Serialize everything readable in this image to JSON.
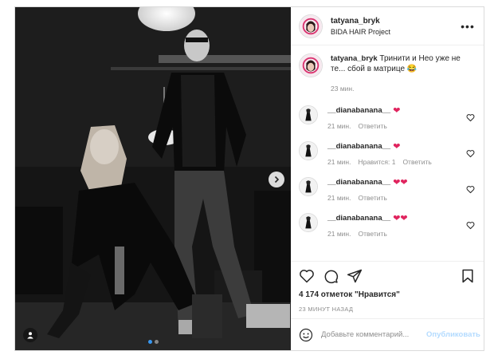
{
  "post": {
    "username": "tatyana_bryk",
    "location": "BIDA HAIR Project",
    "caption_text": "Тринити и Нео уже не те... сбой в матрице 😂",
    "caption_time": "23 мин.",
    "likes": "4 174 отметок \"Нравится\"",
    "posted_ago": "23 МИНУТ НАЗАД",
    "comment_placeholder": "Добавьте комментарий...",
    "publish_label": "Опубликовать",
    "carousel": {
      "total": 2,
      "active": 1
    }
  },
  "comments": [
    {
      "username": "__dianabanana__",
      "hearts": "❤",
      "time": "21 мин.",
      "likes": "",
      "reply": "Ответить"
    },
    {
      "username": "__dianabanana__",
      "hearts": "❤",
      "time": "21 мин.",
      "likes": "Нравится: 1",
      "reply": "Ответить"
    },
    {
      "username": "__dianabanana__",
      "hearts": "❤❤",
      "time": "21 мин.",
      "likes": "",
      "reply": "Ответить"
    },
    {
      "username": "__dianabanana__",
      "hearts": "❤❤",
      "time": "21 мин.",
      "likes": "",
      "reply": "Ответить"
    }
  ],
  "icons": {
    "like": "heart-icon",
    "comment": "comment-icon",
    "share": "share-icon",
    "save": "bookmark-icon",
    "more": "more-icon",
    "emoji": "emoji-icon",
    "next": "chevron-right-icon",
    "tag": "user-tag-icon"
  },
  "colors": {
    "heart": "#e0245e",
    "publish_disabled": "#b3dbff",
    "active_dot": "#3897f0",
    "muted": "#8e8e8e"
  }
}
